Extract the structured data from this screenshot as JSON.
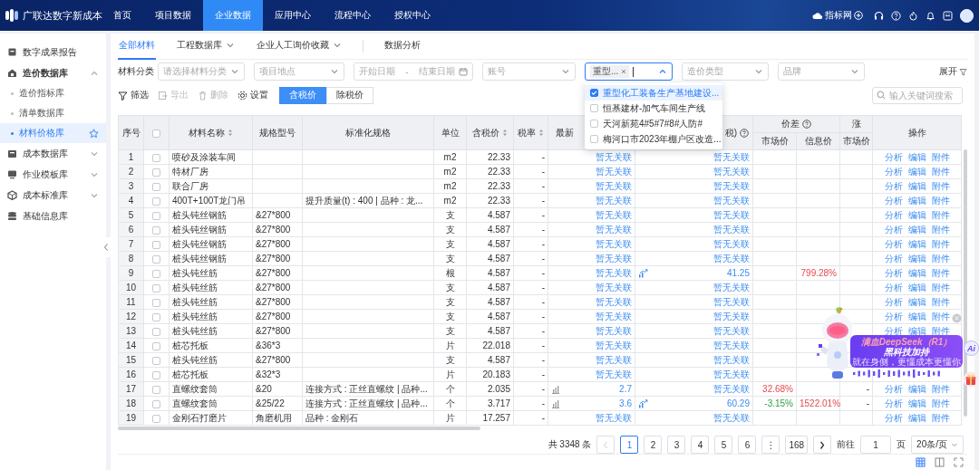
{
  "header": {
    "brand": "广联达数字新成本",
    "nav": [
      {
        "label": "首页",
        "selected": false
      },
      {
        "label": "项目数据",
        "selected": false
      },
      {
        "label": "企业数据",
        "selected": true
      },
      {
        "label": "应用中心",
        "selected": false
      },
      {
        "label": "流程中心",
        "selected": false
      },
      {
        "label": "授权中心",
        "selected": false
      }
    ],
    "portal_label": "指标网"
  },
  "sidebar": {
    "items": [
      {
        "label": "数字成果报告",
        "selected": false
      },
      {
        "label": "造价数据库",
        "selected": false,
        "expanded": true,
        "children": [
          {
            "label": "造价指标库",
            "selected": false
          },
          {
            "label": "清单数据库",
            "selected": false
          },
          {
            "label": "材料价格库",
            "selected": true
          }
        ]
      },
      {
        "label": "成本数据库",
        "selected": false,
        "expanded": false
      },
      {
        "label": "作业模板库",
        "selected": false,
        "expanded": false
      },
      {
        "label": "成本标准库",
        "selected": false,
        "expanded": false
      },
      {
        "label": "基础信息库",
        "selected": false
      }
    ]
  },
  "subtabs": [
    {
      "label": "全部材料",
      "selected": true,
      "has_menu": false
    },
    {
      "label": "工程数据库",
      "selected": false,
      "has_menu": true
    },
    {
      "label": "企业人工询价收藏",
      "selected": false,
      "has_menu": true
    },
    {
      "label": "数据分析",
      "selected": false,
      "has_menu": false
    }
  ],
  "filters": {
    "label": "材料分类",
    "fields": [
      {
        "kind": "select",
        "placeholder": "请选择材料分类"
      },
      {
        "kind": "select",
        "placeholder": "项目地点"
      },
      {
        "kind": "daterange",
        "start_placeholder": "开始日期",
        "separator": "-",
        "end_placeholder": "结束日期"
      },
      {
        "kind": "select",
        "placeholder": "账号"
      },
      {
        "kind": "multiselect",
        "tags": [
          "重型..."
        ],
        "expanded": true,
        "options": [
          {
            "label": "重型化工装备生产基地建设...",
            "checked": true,
            "selected": true
          },
          {
            "label": "恒基建材-加气车间生产线",
            "checked": false,
            "selected": false
          },
          {
            "label": "天河新苑4#5#7#8#人防#",
            "checked": false,
            "selected": false
          },
          {
            "label": "梅河口市2023年棚户区改造...",
            "checked": false,
            "selected": false
          }
        ]
      },
      {
        "kind": "select",
        "placeholder": "造价类型"
      },
      {
        "kind": "select",
        "placeholder": "品牌"
      }
    ],
    "expand_label": "展开"
  },
  "toolbar": {
    "actions": [
      {
        "label": "筛选",
        "disabled": false
      },
      {
        "label": "导出",
        "disabled": true
      },
      {
        "label": "删除",
        "disabled": true
      },
      {
        "label": "设置",
        "disabled": false
      }
    ],
    "price_modes": [
      {
        "label": "含税价",
        "selected": true
      },
      {
        "label": "除税价",
        "selected": false
      }
    ],
    "search": {
      "placeholder": "输入关键词搜索"
    }
  },
  "table": {
    "columns": [
      {
        "kind": "text",
        "label": "序号"
      },
      {
        "kind": "checkbox",
        "checked": false
      },
      {
        "kind": "text",
        "label": "材料名称",
        "sortable": true
      },
      {
        "kind": "text",
        "label": "规格型号"
      },
      {
        "kind": "text",
        "label": "标准化规格"
      },
      {
        "kind": "text",
        "label": "单位"
      },
      {
        "kind": "text",
        "label": "含税价",
        "sortable": true
      },
      {
        "kind": "text",
        "label": "税率",
        "sortable": true
      },
      {
        "kind": "text",
        "label": "最新"
      },
      {
        "kind": "text",
        "label": "税)",
        "help": true
      },
      {
        "kind": "text",
        "label": "价差",
        "help": true,
        "children": [
          {
            "label": "市场价"
          },
          {
            "label": "信息价"
          }
        ]
      },
      {
        "kind": "text",
        "label": "涨",
        "children": [
          {
            "label": "市场价"
          }
        ]
      },
      {
        "kind": "text",
        "label": "操作"
      }
    ],
    "rows": [
      {
        "no": "1",
        "checked": false,
        "name": "喷砂及涂装车间",
        "unit": "m2",
        "price": "22.33",
        "tax": "-",
        "latest": {
          "trend_icon": false,
          "value": "暂无关联"
        },
        "col_9": {
          "trend_icon": false,
          "value": "暂无关联"
        },
        "ops": [
          "分析",
          "编辑",
          "附件"
        ]
      },
      {
        "no": "2",
        "checked": false,
        "name": "特材厂房",
        "unit": "m2",
        "price": "22.33",
        "tax": "-",
        "latest": {
          "trend_icon": false,
          "value": "暂无关联"
        },
        "col_9": {
          "trend_icon": false,
          "value": "暂无关联"
        },
        "ops": [
          "分析",
          "编辑",
          "附件"
        ]
      },
      {
        "no": "3",
        "checked": false,
        "name": "联合厂房",
        "unit": "m2",
        "price": "22.33",
        "tax": "-",
        "latest": {
          "trend_icon": false,
          "value": "暂无关联"
        },
        "col_9": {
          "trend_icon": false,
          "value": "暂无关联"
        },
        "ops": [
          "分析",
          "编辑",
          "附件"
        ]
      },
      {
        "no": "4",
        "checked": false,
        "name": "400T+100T龙门吊",
        "std_spec": "提升质量(t) : 400 | 品种 : 龙...",
        "unit": "m2",
        "price": "22.33",
        "tax": "-",
        "latest": {
          "trend_icon": false,
          "value": "暂无关联"
        },
        "col_9": {
          "trend_icon": false,
          "value": "暂无关联"
        },
        "ops": [
          "分析",
          "编辑",
          "附件"
        ]
      },
      {
        "no": "5",
        "checked": false,
        "name": "桩头钝丝钢筋",
        "spec": "&27*800",
        "unit": "支",
        "price": "4.587",
        "tax": "-",
        "latest": {
          "trend_icon": false,
          "value": "暂无关联"
        },
        "col_9": {
          "trend_icon": false,
          "value": "暂无关联"
        },
        "ops": [
          "分析",
          "编辑",
          "附件"
        ]
      },
      {
        "no": "6",
        "checked": false,
        "name": "桩头钝丝钢筋",
        "spec": "&27*800",
        "unit": "支",
        "price": "4.587",
        "tax": "-",
        "latest": {
          "trend_icon": false,
          "value": "暂无关联"
        },
        "col_9": {
          "trend_icon": false,
          "value": "暂无关联"
        },
        "ops": [
          "分析",
          "编辑",
          "附件"
        ]
      },
      {
        "no": "7",
        "checked": false,
        "name": "桩头钝丝钢筋",
        "spec": "&27*800",
        "unit": "支",
        "price": "4.587",
        "tax": "-",
        "latest": {
          "trend_icon": false,
          "value": "暂无关联"
        },
        "col_9": {
          "trend_icon": false,
          "value": "暂无关联"
        },
        "ops": [
          "分析",
          "编辑",
          "附件"
        ]
      },
      {
        "no": "8",
        "checked": false,
        "name": "桩头钝丝钢筋",
        "spec": "&27*800",
        "unit": "支",
        "price": "4.587",
        "tax": "-",
        "latest": {
          "trend_icon": false,
          "value": "暂无关联"
        },
        "col_9": {
          "trend_icon": false,
          "value": "暂无关联"
        },
        "ops": [
          "分析",
          "编辑",
          "附件"
        ]
      },
      {
        "no": "9",
        "checked": false,
        "name": "桩头钝丝筋",
        "spec": "&27*800",
        "unit": "根",
        "price": "4.587",
        "tax": "-",
        "latest": {
          "trend_icon": false,
          "value": "暂无关联"
        },
        "col_9": {
          "trend_icon": true,
          "value": "41.25"
        },
        "diff_info": {
          "text": "799.28%",
          "rising": true
        },
        "ops": [
          "分析",
          "编辑",
          "附件"
        ]
      },
      {
        "no": "10",
        "checked": false,
        "name": "桩头钝丝筋",
        "spec": "&27*800",
        "unit": "支",
        "price": "4.587",
        "tax": "-",
        "latest": {
          "trend_icon": false,
          "value": "暂无关联"
        },
        "col_9": {
          "trend_icon": false,
          "value": "暂无关联"
        },
        "ops": [
          "分析",
          "编辑",
          "附件"
        ]
      },
      {
        "no": "11",
        "checked": false,
        "name": "桩头钝丝筋",
        "spec": "&27*800",
        "unit": "支",
        "price": "4.587",
        "tax": "-",
        "latest": {
          "trend_icon": false,
          "value": "暂无关联"
        },
        "col_9": {
          "trend_icon": false,
          "value": "暂无关联"
        },
        "ops": [
          "分析",
          "编辑",
          "附件"
        ]
      },
      {
        "no": "12",
        "checked": false,
        "name": "桩头钝丝筋",
        "spec": "&27*800",
        "unit": "支",
        "price": "4.587",
        "tax": "-",
        "latest": {
          "trend_icon": false,
          "value": "暂无关联"
        },
        "col_9": {
          "trend_icon": false,
          "value": "暂无关联"
        },
        "ops": [
          "分析",
          "编辑",
          "附件"
        ]
      },
      {
        "no": "13",
        "checked": false,
        "name": "桩头钝丝筋",
        "spec": "&27*800",
        "unit": "支",
        "price": "4.587",
        "tax": "-",
        "latest": {
          "trend_icon": false,
          "value": "暂无关联"
        },
        "col_9": {
          "trend_icon": false,
          "value": "暂无关联"
        },
        "ops": [
          "分析",
          "编辑",
          "附件"
        ]
      },
      {
        "no": "14",
        "checked": false,
        "name": "桩芯托板",
        "spec": "&36*3",
        "unit": "片",
        "price": "22.018",
        "tax": "-",
        "latest": {
          "trend_icon": false,
          "value": "暂无关联"
        },
        "col_9": {
          "trend_icon": false,
          "value": "暂无关联"
        }
      },
      {
        "no": "15",
        "checked": false,
        "name": "桩头钝丝筋",
        "spec": "&27*800",
        "unit": "支",
        "price": "4.587",
        "tax": "-",
        "latest": {
          "trend_icon": false,
          "value": "暂无关联"
        },
        "col_9": {
          "trend_icon": false,
          "value": "暂无关联"
        }
      },
      {
        "no": "16",
        "checked": false,
        "name": "桩芯托板",
        "spec": "&32*3",
        "unit": "片",
        "price": "20.183",
        "tax": "-",
        "latest": {
          "trend_icon": false,
          "value": "暂无关联"
        },
        "col_9": {
          "trend_icon": false,
          "value": "暂无关联"
        }
      },
      {
        "no": "17",
        "checked": false,
        "name": "直螺纹套筒",
        "spec": "&20",
        "std_spec": "连接方式 : 正丝直螺纹 | 品种...",
        "unit": "个",
        "price": "2.035",
        "tax": "-",
        "latest": {
          "trend_icon": true,
          "value": "2.7"
        },
        "col_9": {
          "trend_icon": false,
          "value": "暂无关联"
        },
        "diff_market": {
          "text": "32.68%",
          "rising": true
        },
        "rise_market": "-",
        "ops": [
          "分析",
          "编辑",
          "附件"
        ]
      },
      {
        "no": "18",
        "checked": false,
        "name": "直螺纹套筒",
        "spec": "&25/22",
        "std_spec": "连接方式 : 正丝直螺纹 | 品种...",
        "unit": "个",
        "price": "3.717",
        "tax": "-",
        "latest": {
          "trend_icon": true,
          "value": "3.6"
        },
        "col_9": {
          "trend_icon": true,
          "value": "60.29"
        },
        "diff_market": {
          "text": "-3.15%",
          "rising": false
        },
        "diff_info": {
          "text": "1522.01%",
          "rising": true
        },
        "rise_market": "-",
        "ops": [
          "分析",
          "编辑",
          "附件"
        ]
      },
      {
        "no": "19",
        "checked": false,
        "name": "金刚石打磨片",
        "spec": "角磨机用",
        "std_spec": "品种 : 金刚石",
        "unit": "片",
        "price": "17.257",
        "tax": "-",
        "latest": {
          "trend_icon": false,
          "value": "暂无关联"
        },
        "col_9": {
          "trend_icon": false,
          "value": "暂无关联"
        },
        "ops": [
          "分析",
          "编辑",
          "附件"
        ]
      }
    ]
  },
  "pagination": {
    "total": "共 3348 条",
    "prev_disabled": true,
    "pages": [
      {
        "label": "1",
        "selected": true
      },
      {
        "label": "2",
        "selected": false
      },
      {
        "label": "3",
        "selected": false
      },
      {
        "label": "4",
        "selected": false
      },
      {
        "label": "5",
        "selected": false
      },
      {
        "label": "6",
        "selected": false
      },
      {
        "label": "⋮",
        "selected": false
      },
      {
        "label": "168",
        "selected": false
      }
    ],
    "next_disabled": false,
    "goto_label": "前往",
    "goto_value": "1",
    "page_unit": "页",
    "page_size": "20条/页"
  },
  "view_modes": [
    {
      "selected": true
    },
    {
      "selected": false
    },
    {
      "selected": false
    }
  ],
  "assistant": {
    "title": "满血DeepSeek（R1）",
    "subtitle": "黑科技加持",
    "tagline": "就在身侧，更懂成本更懂你"
  },
  "ai_button": "Ai"
}
